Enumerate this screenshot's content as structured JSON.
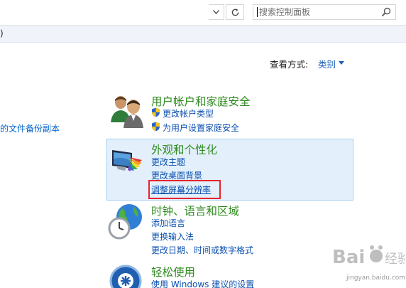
{
  "address_bar": {
    "search_placeholder": "搜索控制面板"
  },
  "menu_strip": {
    "fragment": ")"
  },
  "view_by": {
    "label": "查看方式:",
    "value": "类别"
  },
  "left_panel": {
    "truncated_link": "的文件备份副本"
  },
  "categories": [
    {
      "title": "用户帐户和家庭安全",
      "links": [
        "更改帐户类型",
        "为用户设置家庭安全"
      ]
    },
    {
      "title": "外观和个性化",
      "links": [
        "更改主题",
        "更改桌面背景",
        "调整屏幕分辨率"
      ]
    },
    {
      "title": "时钟、语言和区域",
      "links": [
        "添加语言",
        "更换输入法",
        "更改日期、时间或数字格式"
      ]
    },
    {
      "title": "轻松使用",
      "links": [
        "使用 Windows 建议的设置"
      ]
    }
  ],
  "watermark": {
    "text": "jingyan.baidu.com"
  },
  "colors": {
    "category_title": "#2f8b1f",
    "link": "#0a4fb0",
    "highlight_bg": "#e3f0fb",
    "annotation_red": "#e8232f"
  },
  "icons": [
    "chevron-down-icon",
    "refresh-icon",
    "search-icon",
    "users-icon",
    "shield-icon",
    "display-colors-icon",
    "globe-clock-icon",
    "ease-of-access-icon"
  ]
}
